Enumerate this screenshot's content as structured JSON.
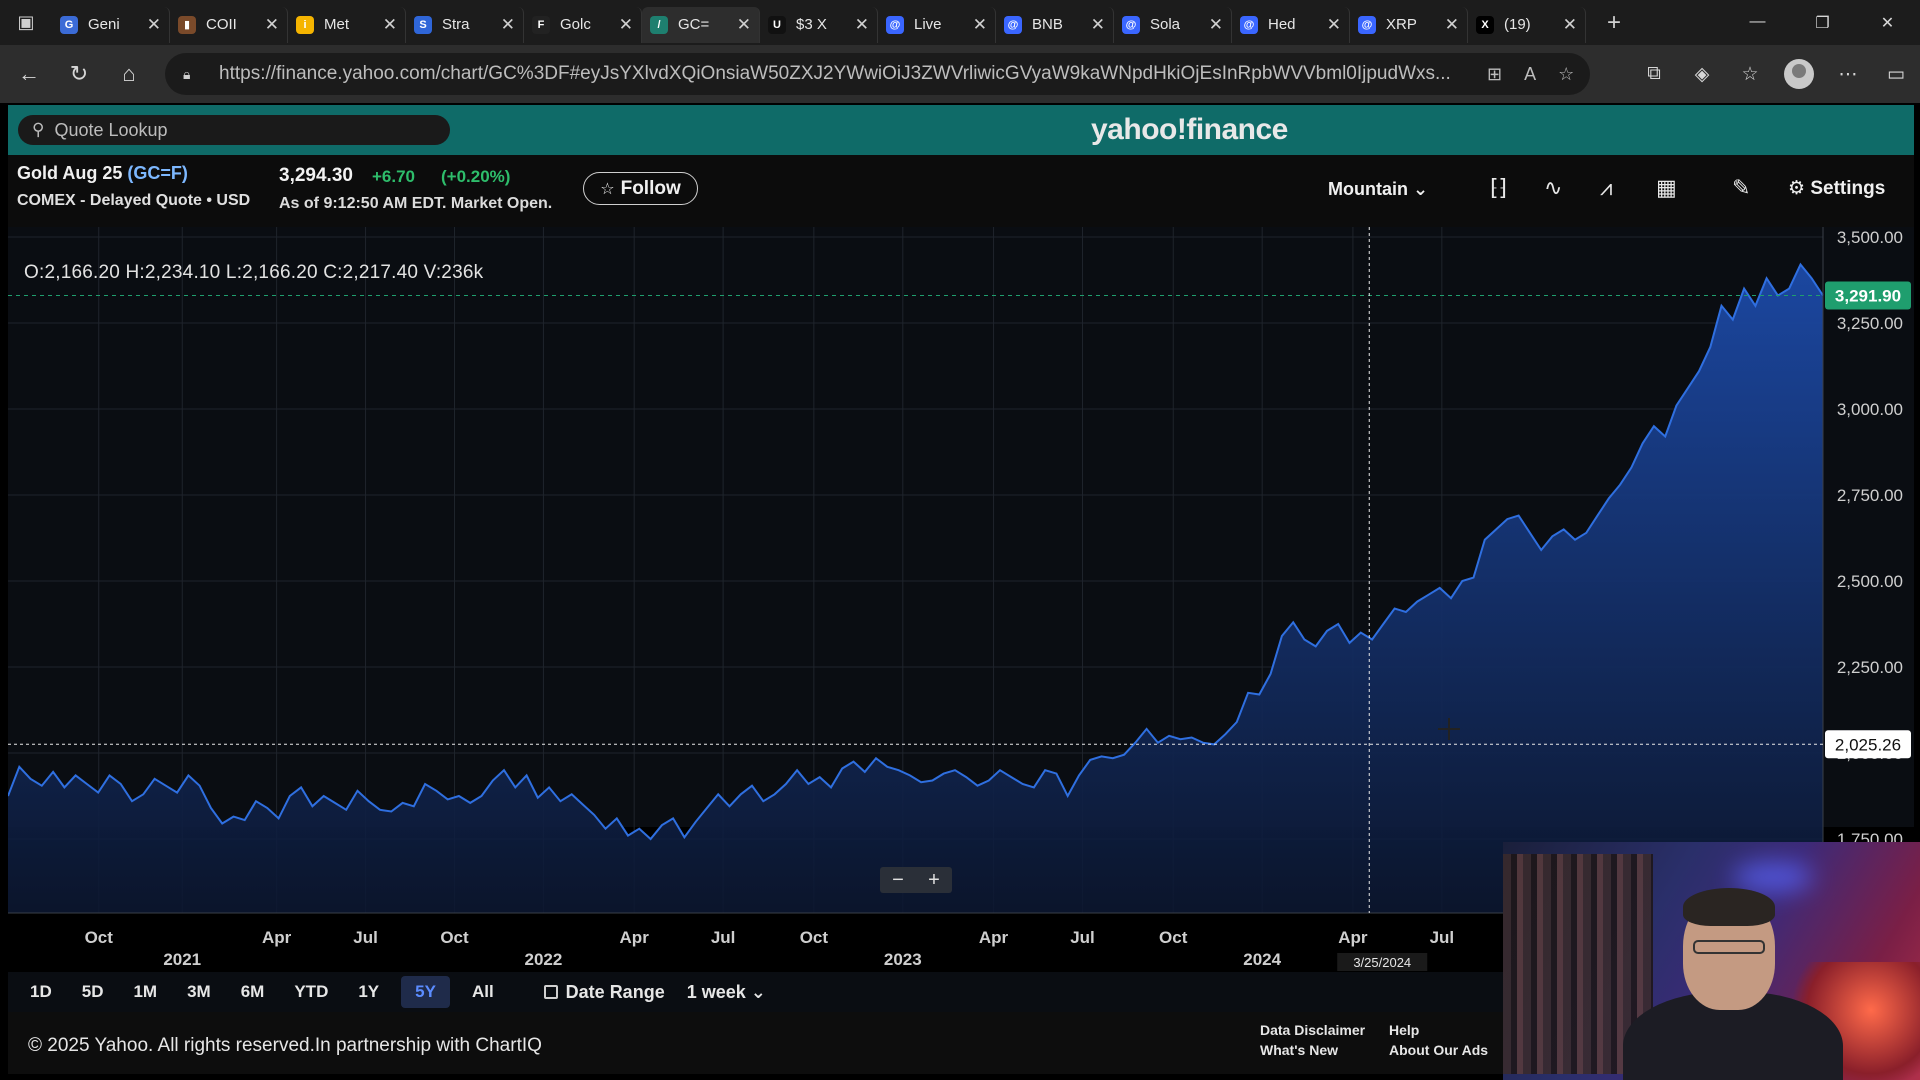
{
  "browser": {
    "tabs": [
      {
        "title": "Geni",
        "fav_color": "#3b6bd6",
        "fav_glyph": "G"
      },
      {
        "title": "COII",
        "fav_color": "#7a4a2a",
        "fav_glyph": "▮"
      },
      {
        "title": "Met",
        "fav_color": "#f5b400",
        "fav_glyph": "i"
      },
      {
        "title": "Stra",
        "fav_color": "#2f66d8",
        "fav_glyph": "S"
      },
      {
        "title": "Golc",
        "fav_color": "#222222",
        "fav_glyph": "F"
      },
      {
        "title": "GC=",
        "fav_color": "#1e7f6f",
        "fav_glyph": "/"
      },
      {
        "title": "$3 X",
        "fav_color": "#111111",
        "fav_glyph": "U"
      },
      {
        "title": "Live",
        "fav_color": "#3a66ff",
        "fav_glyph": "@"
      },
      {
        "title": "BNB",
        "fav_color": "#3a66ff",
        "fav_glyph": "@"
      },
      {
        "title": "Sola",
        "fav_color": "#3a66ff",
        "fav_glyph": "@"
      },
      {
        "title": "Hed",
        "fav_color": "#3a66ff",
        "fav_glyph": "@"
      },
      {
        "title": "XRP",
        "fav_color": "#3a66ff",
        "fav_glyph": "@"
      },
      {
        "title": "(19)",
        "fav_color": "#000000",
        "fav_glyph": "X"
      }
    ],
    "url": "https://finance.yahoo.com/chart/GC%3DF#eyJsYXlvdXQiOnsiaW50ZXJ2YWwiOiJ3ZWVrliwicGVyaW9kaWNpdHkiOjEsInRpbWVVbml0IjpudWxs..."
  },
  "yahoo": {
    "search_placeholder": "Quote Lookup",
    "logo": "yahoo!finance"
  },
  "quote": {
    "name": "Gold Aug 25 ",
    "symbol": "(GC=F)",
    "subtitle": "COMEX - Delayed Quote • USD",
    "price": "3,294.30",
    "change": "+6.70",
    "change_pct": "(+0.20%)",
    "as_of": "As of 9:12:50 AM EDT. Market Open.",
    "follow_label": "Follow",
    "chart_style": "Mountain",
    "settings_label": "Settings"
  },
  "chart_data": {
    "type": "area",
    "ohlc_readout": "O:2,166.20  H:2,234.10  L:2,166.20  C:2,217.40  V:236k",
    "y_ticks": [
      "3,500.00",
      "3,250.00",
      "3,000.00",
      "2,750.00",
      "2,500.00",
      "2,250.00",
      "2,000.00",
      "1,750.00"
    ],
    "y_tick_values": [
      3500,
      3250,
      3000,
      2750,
      2500,
      2250,
      2000,
      1750
    ],
    "ylim": [
      1750,
      3500
    ],
    "x_month_labels": [
      "Oct",
      "Apr",
      "Jul",
      "Oct",
      "Apr",
      "Jul",
      "Oct",
      "Apr",
      "Jul",
      "Oct",
      "Apr",
      "Jul"
    ],
    "x_year_labels": [
      "2021",
      "2022",
      "2023",
      "2024"
    ],
    "crosshair_date": "3/25/2024",
    "crosshair_value": "2,025.26",
    "last_price_label": "3,291.90",
    "colors": {
      "line": "#2f6fe0",
      "fill_top": "#1c4aa8",
      "fill_bottom": "#0c1730",
      "last_badge": "#1f9e6e"
    },
    "series": [
      {
        "values": [
          1875,
          1960,
          1925,
          1905,
          1945,
          1900,
          1935,
          1910,
          1885,
          1935,
          1910,
          1860,
          1880,
          1925,
          1905,
          1885,
          1935,
          1905,
          1840,
          1795,
          1815,
          1805,
          1860,
          1840,
          1810,
          1875,
          1900,
          1845,
          1875,
          1855,
          1835,
          1890,
          1860,
          1835,
          1830,
          1855,
          1845,
          1910,
          1890,
          1865,
          1875,
          1855,
          1875,
          1920,
          1950,
          1900,
          1935,
          1870,
          1900,
          1860,
          1880,
          1850,
          1820,
          1780,
          1810,
          1760,
          1780,
          1750,
          1790,
          1810,
          1755,
          1800,
          1840,
          1880,
          1845,
          1880,
          1905,
          1860,
          1880,
          1910,
          1950,
          1910,
          1930,
          1900,
          1955,
          1975,
          1945,
          1985,
          1960,
          1950,
          1935,
          1915,
          1920,
          1940,
          1950,
          1930,
          1905,
          1920,
          1950,
          1930,
          1910,
          1900,
          1950,
          1940,
          1875,
          1935,
          1980,
          1990,
          1985,
          1995,
          2030,
          2070,
          2030,
          2050,
          2040,
          2045,
          2030,
          2025,
          2055,
          2090,
          2175,
          2170,
          2230,
          2340,
          2380,
          2330,
          2310,
          2355,
          2375,
          2320,
          2350,
          2330,
          2375,
          2420,
          2410,
          2440,
          2460,
          2480,
          2450,
          2500,
          2510,
          2620,
          2650,
          2680,
          2690,
          2640,
          2590,
          2630,
          2650,
          2620,
          2640,
          2690,
          2740,
          2780,
          2830,
          2900,
          2950,
          2920,
          3010,
          3060,
          3110,
          3180,
          3300,
          3260,
          3350,
          3300,
          3380,
          3330,
          3350,
          3420,
          3380,
          3330
        ]
      }
    ]
  },
  "ranges": [
    "1D",
    "5D",
    "1M",
    "3M",
    "6M",
    "YTD",
    "1Y",
    "5Y",
    "All"
  ],
  "selected_range": "5Y",
  "date_range_label": "Date Range",
  "interval_label": "1 week ⌄",
  "footer": {
    "copyright": "© 2025 Yahoo. All rights reserved.In partnership with ChartIQ",
    "links": [
      "Data Disclaimer",
      "What's New",
      "Help",
      "About Our Ads"
    ]
  }
}
